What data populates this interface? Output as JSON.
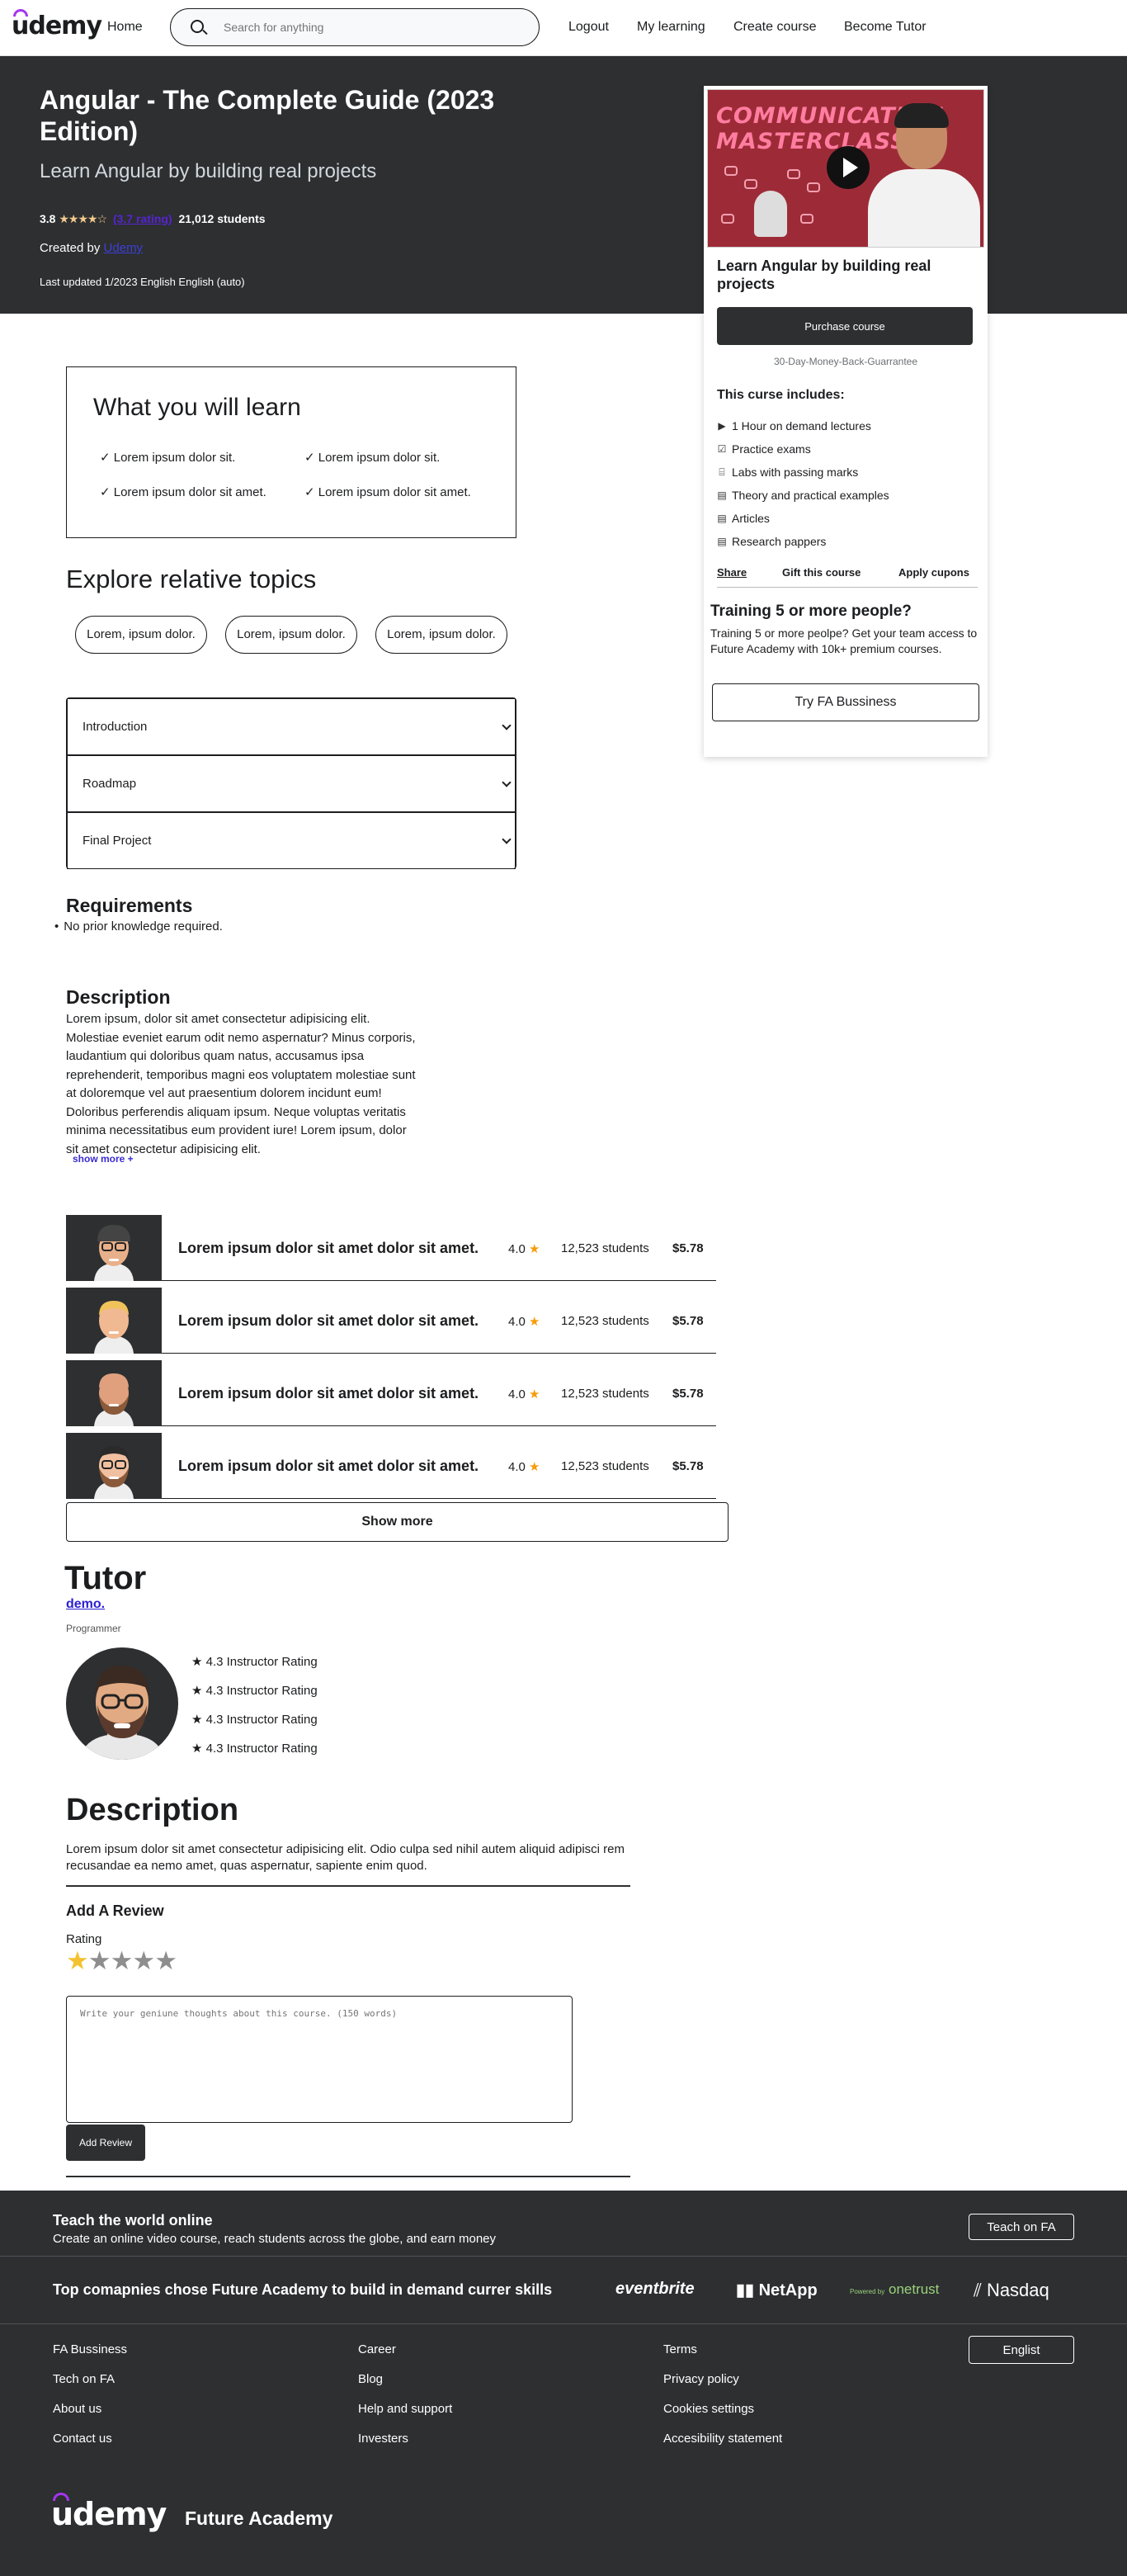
{
  "nav": {
    "logo": "udemy",
    "home": "Home",
    "search_placeholder": "Search for anything",
    "logout": "Logout",
    "my_learning": "My learning",
    "create_course": "Create course",
    "become_tutor": "Become Tutor"
  },
  "hero": {
    "title": "Angular - The Complete Guide (2023 Edition)",
    "subtitle": "Learn Angular by building real projects",
    "rating": "3.8",
    "stars": "★★★★☆",
    "ratings_link": "(3.7 rating)",
    "students": "21,012 students",
    "created_by_label": "Created by",
    "creator": "Udemy",
    "updated": "Last updated 1/2023 English English (auto)"
  },
  "card": {
    "thumb_text_1": "COMMUNICATION",
    "thumb_text_2": "MASTERCLASS",
    "title": "Learn Angular by building real projects",
    "purchase": "Purchase course",
    "guarantee": "30-Day-Money-Back-Guarrantee",
    "includes_title": "This curse includes:",
    "includes": [
      {
        "icon": "play-circle-icon",
        "glyph": "▶",
        "label": "1 Hour on demand lectures"
      },
      {
        "icon": "checklist-icon",
        "glyph": "☑",
        "label": "Practice exams"
      },
      {
        "icon": "lab-icon",
        "glyph": "⌸",
        "label": "Labs with passing marks"
      },
      {
        "icon": "file-icon",
        "glyph": "▤",
        "label": "Theory and practical examples"
      },
      {
        "icon": "file-icon",
        "glyph": "▤",
        "label": "Articles"
      },
      {
        "icon": "file-icon",
        "glyph": "▤",
        "label": "Research pappers"
      }
    ],
    "share": "Share",
    "gift": "Gift this course",
    "coupons": "Apply cupons",
    "training_title": "Training 5 or more people?",
    "training_text": "Training 5 or more peolpe? Get your team access to Future Academy with 10k+ premium courses.",
    "try_fa": "Try FA Bussiness"
  },
  "learn": {
    "title": "What you will learn",
    "items": [
      "✓ Lorem ipsum dolor sit.",
      "✓ Lorem ipsum dolor sit.",
      "✓ Lorem ipsum dolor sit amet.",
      "✓ Lorem ipsum dolor sit amet."
    ]
  },
  "topics": {
    "title": "Explore relative topics",
    "pills": [
      "Lorem, ipsum dolor.",
      "Lorem, ipsum dolor.",
      "Lorem, ipsum dolor."
    ]
  },
  "accordion": [
    "Introduction",
    "Roadmap",
    "Final Project"
  ],
  "requirements": {
    "title": "Requirements",
    "items": [
      "No prior knowledge required."
    ]
  },
  "description": {
    "title": "Description",
    "text": "Lorem ipsum, dolor sit amet consectetur adipisicing elit. Molestiae eveniet earum odit nemo aspernatur? Minus corporis, laudantium qui doloribus quam natus, accusamus ipsa reprehenderit, temporibus magni eos voluptatem molestiae sunt at doloremque vel aut praesentium dolorem incidunt eum! Doloribus perferendis aliquam ipsum. Neque voluptas veritatis minima necessitatibus eum provident iure! Lorem ipsum, dolor sit amet consectetur adipisicing elit.",
    "show_more": "show more +"
  },
  "courses": [
    {
      "title": "Lorem ipsum dolor sit amet dolor sit amet.",
      "rating": "4.0",
      "students": "12,523 students",
      "price": "$5.78"
    },
    {
      "title": "Lorem ipsum dolor sit amet dolor sit amet.",
      "rating": "4.0",
      "students": "12,523 students",
      "price": "$5.78"
    },
    {
      "title": "Lorem ipsum dolor sit amet dolor sit amet.",
      "rating": "4.0",
      "students": "12,523 students",
      "price": "$5.78"
    },
    {
      "title": "Lorem ipsum dolor sit amet dolor sit amet.",
      "rating": "4.0",
      "students": "12,523 students",
      "price": "$5.78"
    }
  ],
  "show_more_btn": "Show more",
  "tutor": {
    "title": "Tutor",
    "name": "demo.",
    "role": "Programmer",
    "ratings": [
      "★ 4.3 Instructor Rating",
      "★ 4.3 Instructor Rating",
      "★ 4.3 Instructor Rating",
      "★ 4.3 Instructor Rating"
    ]
  },
  "tutor_description": {
    "title": "Description",
    "text": "Lorem ipsum dolor sit amet consectetur adipisicing elit. Odio culpa sed nihil autem aliquid adipisci rem recusandae ea nemo amet, quas aspernatur, sapiente enim quod."
  },
  "review": {
    "title": "Add A Review",
    "rating_label": "Rating",
    "stars_selected": 1,
    "stars_total": 5,
    "placeholder": "Write your geniune thoughts about this course. (150 words)",
    "submit": "Add Review"
  },
  "footer": {
    "teach_title": "Teach the world online",
    "teach_sub": "Create an online video course, reach students across the globe, and earn money",
    "teach_btn": "Teach on FA",
    "companies_text": "Top comapnies chose Future Academy to build in demand currer skills",
    "brands": [
      "eventbrite",
      "NetApp",
      "onetrust",
      "Nasdaq"
    ],
    "brand_small": "Powered by",
    "col1": [
      "FA Bussiness",
      "Tech on FA",
      "About us",
      "Contact us"
    ],
    "col2": [
      "Career",
      "Blog",
      "Help and support",
      "Investers"
    ],
    "col3": [
      "Terms",
      "Privacy policy",
      "Cookies settings",
      "Accesibility statement"
    ],
    "language": "Englist",
    "logo": "udemy",
    "name": "Future Academy"
  },
  "colors": {
    "dark": "#2d2f31",
    "accent": "#a435f0",
    "star": "#f69c08"
  }
}
